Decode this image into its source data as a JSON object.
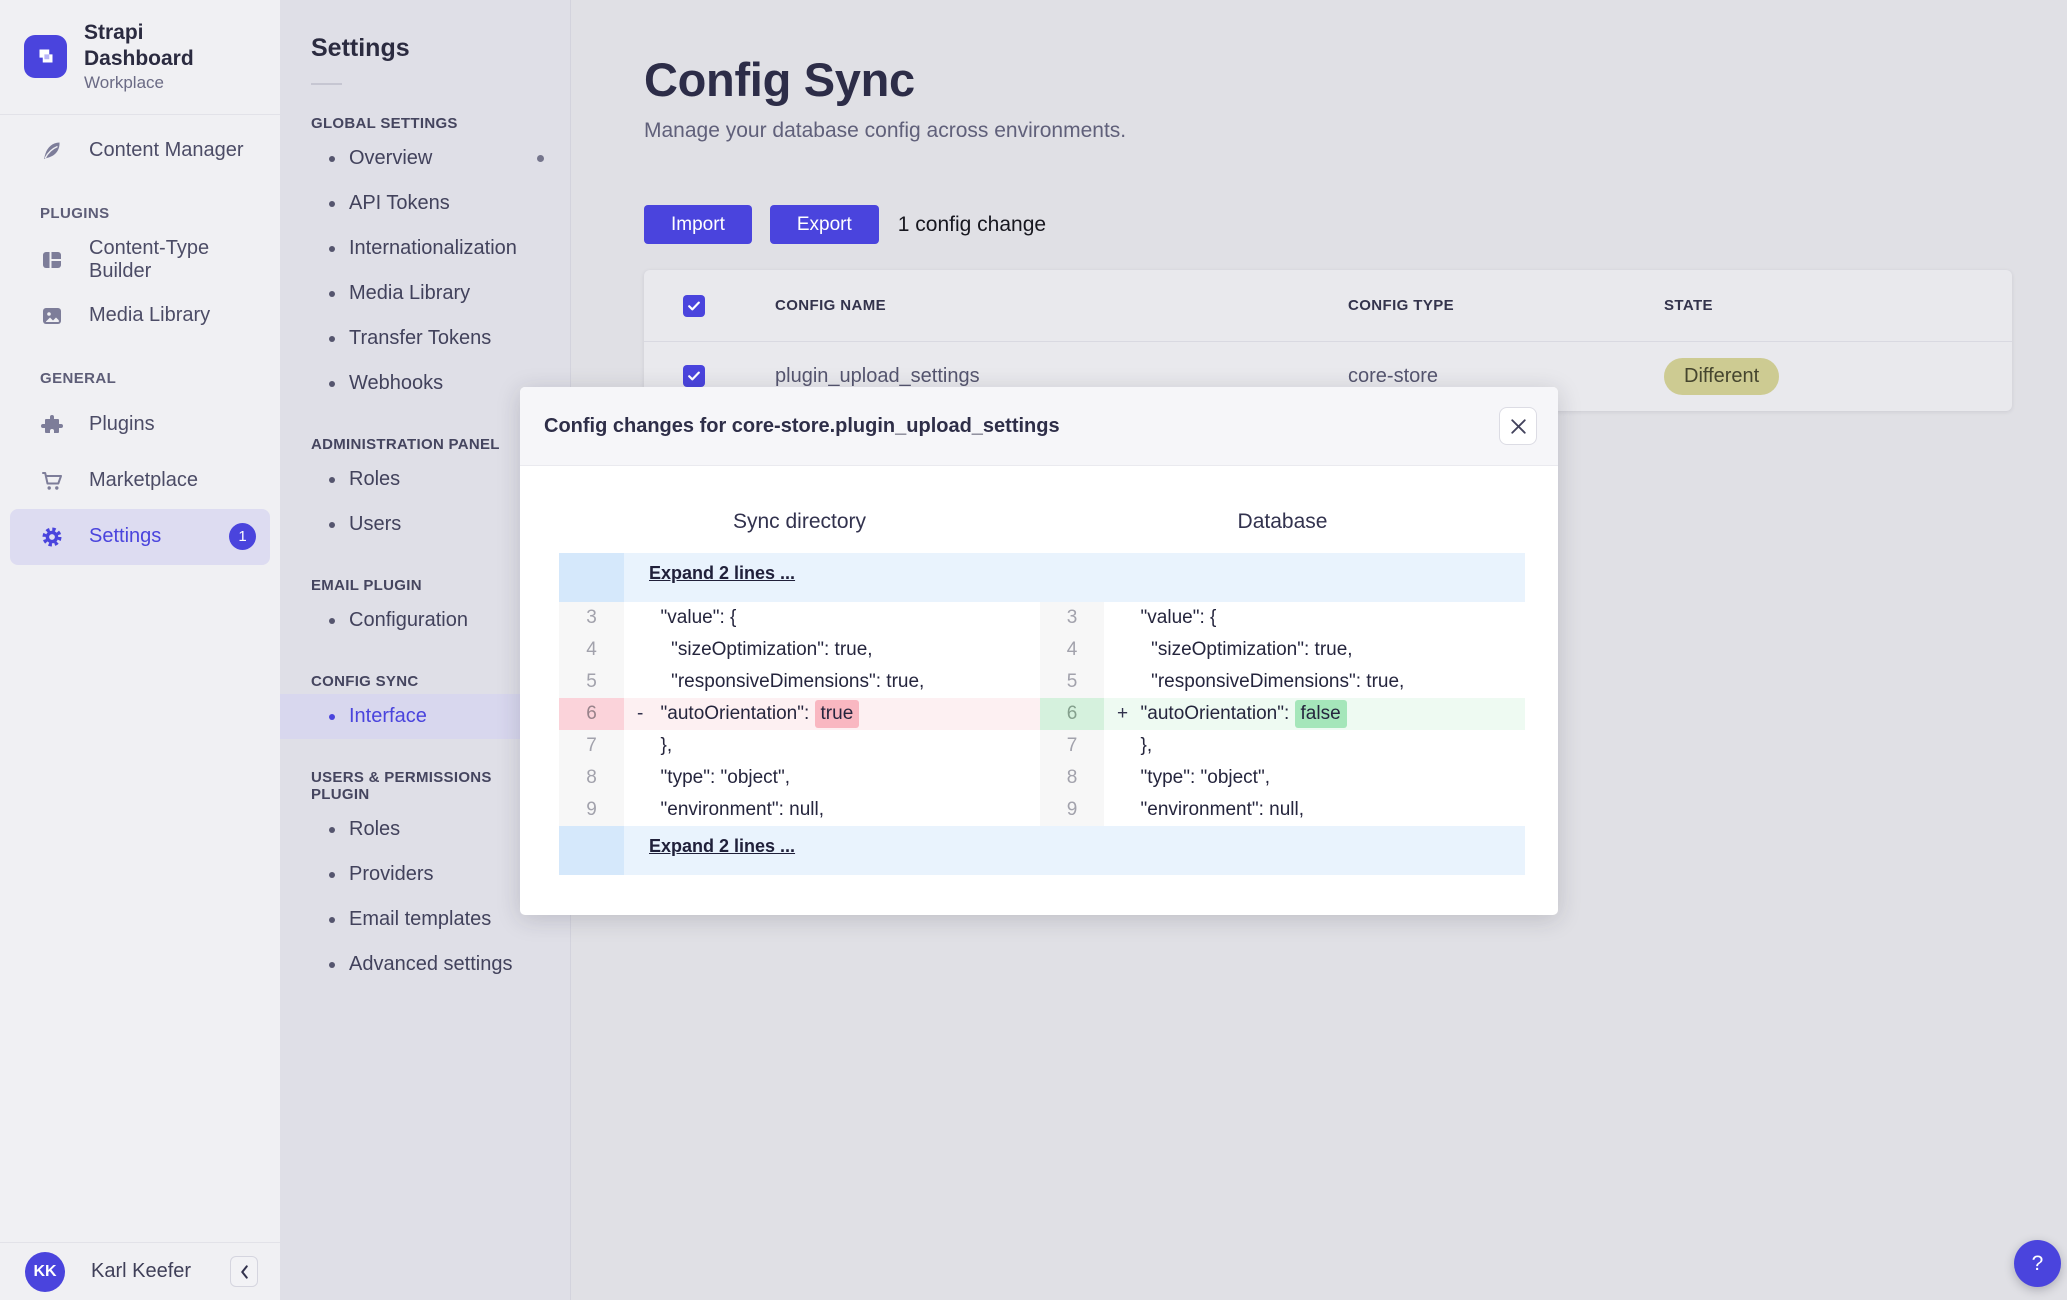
{
  "nav": {
    "app_title": "Strapi Dashboard",
    "workspace": "Workplace",
    "content_manager": "Content Manager",
    "plugins_section": "PLUGINS",
    "content_type_builder": "Content-Type Builder",
    "media_library": "Media Library",
    "general_section": "GENERAL",
    "plugins": "Plugins",
    "marketplace": "Marketplace",
    "settings": "Settings",
    "settings_badge": "1",
    "user_initials": "KK",
    "user_name": "Karl Keefer"
  },
  "subnav": {
    "title": "Settings",
    "sections": [
      {
        "label": "GLOBAL SETTINGS",
        "items": [
          "Overview",
          "API Tokens",
          "Internationalization",
          "Media Library",
          "Transfer Tokens",
          "Webhooks"
        ]
      },
      {
        "label": "ADMINISTRATION PANEL",
        "items": [
          "Roles",
          "Users"
        ]
      },
      {
        "label": "EMAIL PLUGIN",
        "items": [
          "Configuration"
        ]
      },
      {
        "label": "CONFIG SYNC",
        "items": [
          "Interface"
        ]
      },
      {
        "label": "USERS & PERMISSIONS PLUGIN",
        "items": [
          "Roles",
          "Providers",
          "Email templates",
          "Advanced settings"
        ]
      }
    ]
  },
  "header": {
    "title": "Config Sync",
    "subtitle": "Manage your database config across environments."
  },
  "toolbar": {
    "import_label": "Import",
    "export_label": "Export",
    "change_count": "1 config change"
  },
  "table": {
    "headers": [
      "CONFIG NAME",
      "CONFIG TYPE",
      "STATE"
    ],
    "rows": [
      {
        "name": "plugin_upload_settings",
        "type": "core-store",
        "state": "Different"
      }
    ]
  },
  "modal": {
    "title": "Config changes for core-store.plugin_upload_settings",
    "left_header": "Sync directory",
    "right_header": "Database",
    "diff": {
      "expand_top": "Expand 2 lines ...",
      "expand_bottom": "Expand 2 lines ...",
      "rows": [
        {
          "num": "3",
          "left": "  \"value\": {",
          "right": "  \"value\": {"
        },
        {
          "num": "4",
          "left": "    \"sizeOptimization\": true,",
          "right": "    \"sizeOptimization\": true,"
        },
        {
          "num": "5",
          "left": "    \"responsiveDimensions\": true,",
          "right": "    \"responsiveDimensions\": true,"
        },
        {
          "num": "6",
          "left_marker": "-",
          "left_pre": "  \"autoOrientation\": ",
          "left_hl": "true",
          "right_marker": "+",
          "right_pre": "  \"autoOrientation\": ",
          "right_hl": "false"
        },
        {
          "num": "7",
          "left": "  },",
          "right": "  },"
        },
        {
          "num": "8",
          "left": "  \"type\": \"object\",",
          "right": "  \"type\": \"object\","
        },
        {
          "num": "9",
          "left": "  \"environment\": null,",
          "right": "  \"environment\": null,"
        }
      ]
    }
  },
  "help": {
    "label": "?"
  },
  "colors": {
    "accent": "#4a44dd",
    "state_badge_bg": "#cdcb92",
    "state_badge_text": "#45452e",
    "removed_row": "#fdf0f2",
    "removed_gutter": "#fbd3da",
    "removed_highlight": "#f9b7c1",
    "added_row": "#eefaf2",
    "added_gutter": "#d5f1dd",
    "added_highlight": "#a5e6ba",
    "expand_row": "#e9f3fd",
    "expand_gutter": "#d5e8fb"
  }
}
